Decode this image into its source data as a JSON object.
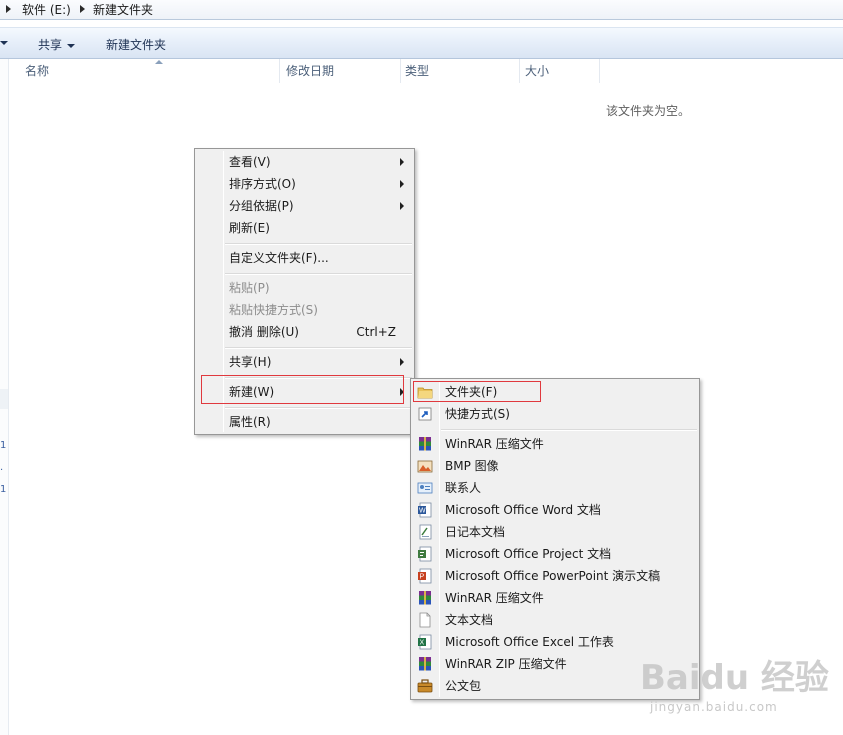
{
  "breadcrumb": {
    "drive": "软件 (E:)",
    "folder": "新建文件夹"
  },
  "toolbar": {
    "share_label": "共享",
    "new_folder_label": "新建文件夹"
  },
  "columns": {
    "name": "名称",
    "modified": "修改日期",
    "type": "类型",
    "size": "大小"
  },
  "empty_message": "该文件夹为空。",
  "nav_marks": [
    "1",
    ".",
    "1"
  ],
  "context_menu": {
    "view": "查看(V)",
    "sort_by": "排序方式(O)",
    "group_by": "分组依据(P)",
    "refresh": "刷新(E)",
    "customize": "自定义文件夹(F)...",
    "paste": "粘贴(P)",
    "paste_shortcut": "粘贴快捷方式(S)",
    "undo_delete": "撤消 删除(U)",
    "undo_shortcut": "Ctrl+Z",
    "share": "共享(H)",
    "new": "新建(W)",
    "properties": "属性(R)"
  },
  "new_submenu": {
    "folder": "文件夹(F)",
    "shortcut": "快捷方式(S)",
    "winrar_archive": "WinRAR 压缩文件",
    "bmp_image": "BMP 图像",
    "contact": "联系人",
    "word_doc": "Microsoft Office Word 文档",
    "journal_doc": "日记本文档",
    "project_doc": "Microsoft Office Project 文档",
    "ppt_doc": "Microsoft Office PowerPoint 演示文稿",
    "winrar_archive_2": "WinRAR 压缩文件",
    "text_doc": "文本文档",
    "excel_doc": "Microsoft Office Excel 工作表",
    "winrar_zip": "WinRAR ZIP 压缩文件",
    "briefcase": "公文包"
  },
  "watermark": {
    "logo": "Baidu 经验",
    "url": "jingyan.baidu.com"
  },
  "colors": {
    "highlight_border": "#e0393e",
    "menu_bg": "#f0f0f0"
  }
}
